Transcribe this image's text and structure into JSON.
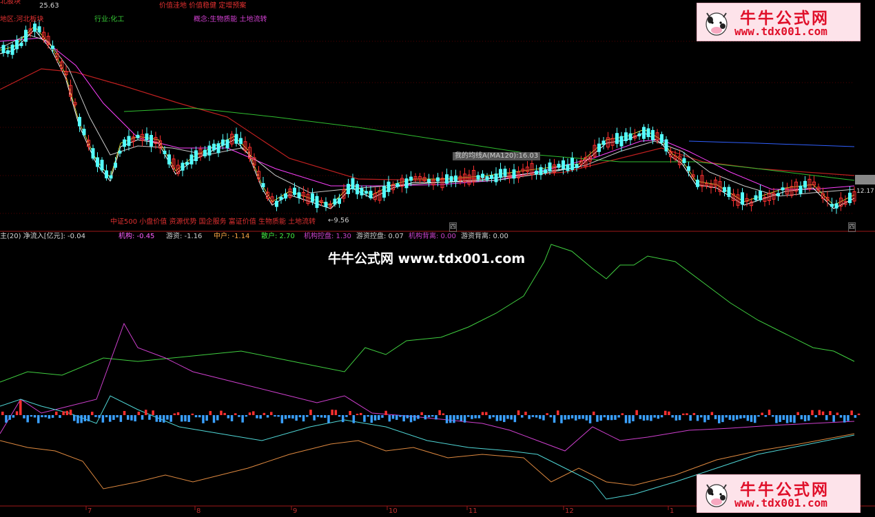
{
  "top": {
    "block_label": "北股块",
    "high_price": "25.63",
    "tags_label": "价值洼地 价值稳健 定增预案"
  },
  "info": {
    "region": "地区:河北板块",
    "industry": "行业:化工",
    "concept": "概念:生物质能 土地流转"
  },
  "main_chart": {
    "ma_label": "我的均线A(MA120):16.03",
    "low_price": "←9.56",
    "last_price": "12.17",
    "concept_line": "中证500 小盘价值 资源优势 国企服务 富证价值 生物质能 土地流转",
    "markers": [
      "四",
      "四"
    ]
  },
  "indicator": {
    "title": "主(20) 净流入[亿元]: -0.04",
    "values": [
      {
        "label": "机构: -0.45",
        "color": "#ff60ff"
      },
      {
        "label": "游资: -1.16",
        "color": "#d0d0d0"
      },
      {
        "label": "中户: -1.14",
        "color": "#ffaa44"
      },
      {
        "label": "散户: 2.70",
        "color": "#44ee44"
      },
      {
        "label": "机构控盘: 1.30",
        "color": "#cc44cc"
      },
      {
        "label": "游资控盘: 0.07",
        "color": "#d0d0d0"
      },
      {
        "label": "机构背离: 0.00",
        "color": "#cc44cc"
      },
      {
        "label": "游资背离: 0.00",
        "color": "#d0d0d0"
      }
    ]
  },
  "x_axis": {
    "labels": [
      "7",
      "8",
      "9",
      "10",
      "11",
      "12",
      "1"
    ]
  },
  "watermark": {
    "name": "牛牛公式网",
    "url": "www.tdx001.com",
    "banner": "牛牛公式网 www.tdx001.com"
  },
  "colors": {
    "up": "#ff3030",
    "down": "#54ffff",
    "ma_white": "#ffffff",
    "ma_yellow": "#ffff44",
    "ma_purple": "#ff40ff",
    "ma_green": "#30c030",
    "ma_red": "#c02020",
    "ma_blue": "#3060ff"
  }
}
